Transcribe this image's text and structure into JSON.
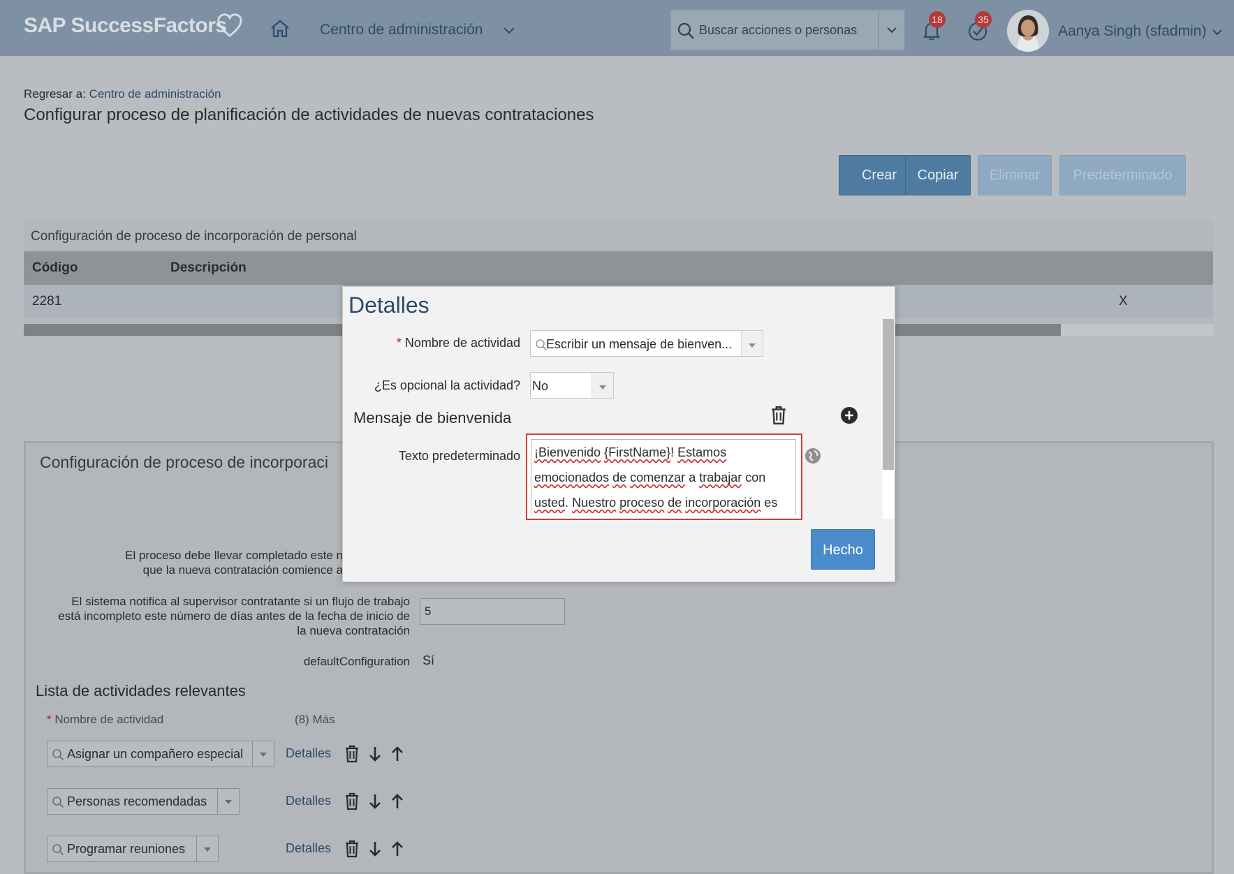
{
  "shell": {
    "logo": "SAP SuccessFactors",
    "nav_title": "Centro de administración",
    "search_placeholder": "Buscar acciones o personas",
    "notifications_count": "18",
    "tasks_count": "35",
    "user_name": "Aanya Singh (sfadmin)"
  },
  "page": {
    "back_prefix": "Regresar a:",
    "back_link": "Centro de administración",
    "title": "Configurar proceso de planificación de actividades de nuevas contrataciones",
    "buttons": {
      "create": "Crear",
      "copy": "Copiar",
      "delete": "Eliminar",
      "default": "Predeterminado"
    }
  },
  "process_table": {
    "title": "Configuración de proceso de incorporación de personal",
    "columns": [
      "Código",
      "Descripción"
    ],
    "rows": [
      {
        "code": "2281",
        "extra": "X"
      }
    ]
  },
  "process_detail": {
    "title": "Configuración de proceso de incorporaci",
    "label_days_line1": "El proceso debe llevar completado este número de d",
    "label_days_line2": "que la nueva contratación comience a trabajar en",
    "label_notify_line1": "El sistema notifica al supervisor contratante si un flujo de trabajo",
    "label_notify_line2": "está incompleto este número de días antes de la fecha de inicio de",
    "label_notify_line3": "la nueva contratación",
    "notify_days_value": "5",
    "default_config_label": "defaultConfiguration",
    "default_config_value": "Sí",
    "activities_title": "Lista de actividades relevantes",
    "activity_name_header": "Nombre de actividad",
    "more_label": "(8) Más",
    "details_link": "Detalles",
    "activities": [
      "Asignar un compañero especial",
      "Personas recomendadas",
      "Programar reuniones"
    ]
  },
  "modal": {
    "title": "Detalles",
    "activity_name_label": "Nombre de actividad",
    "activity_name_value": "Escribir un mensaje de bienven...",
    "optional_label": "¿Es opcional la actividad?",
    "optional_value": "No",
    "welcome_heading": "Mensaje de bienvenida",
    "default_text_label": "Texto predeterminado",
    "default_text_words": [
      "¡Bienvenido",
      "{FirstName}",
      "! ",
      "Estamos",
      "emocionados",
      "de",
      "comenzar",
      "a",
      "trabajar",
      "con",
      "usted",
      ". ",
      "Nuestro",
      "proceso",
      "de",
      "incorporación",
      "es"
    ],
    "done_button": "Hecho"
  },
  "colors": {
    "shell_bg": "#7e91a4",
    "page_overlay_bg": "#b9bcc1",
    "primary_button": "#4f7ba2",
    "done_button": "#4a8bcb",
    "highlight_border": "#d63a3a",
    "badge": "#b33a3a"
  }
}
